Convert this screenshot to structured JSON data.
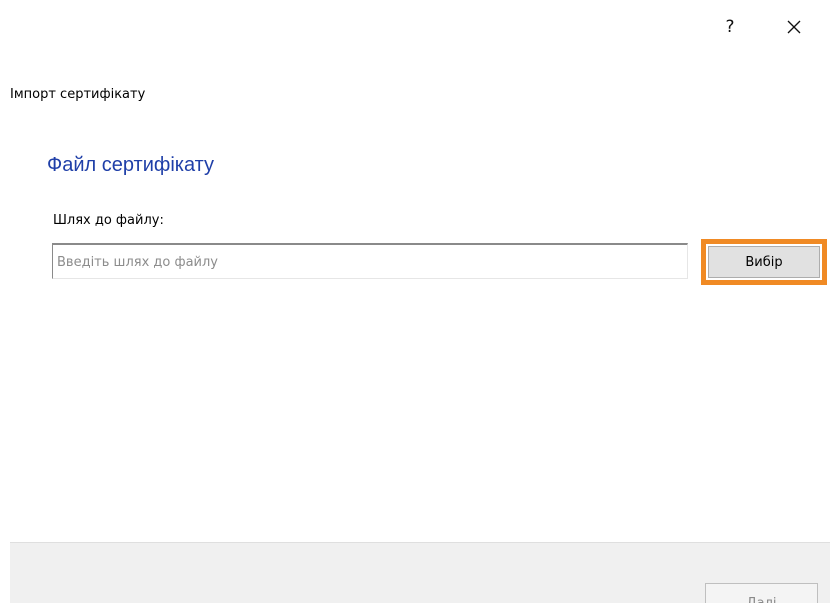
{
  "window": {
    "help_label": "?",
    "close_icon": "close-icon"
  },
  "wizard": {
    "title": "Імпорт сертифікату"
  },
  "section": {
    "heading": "Файл сертифікату",
    "path_label": "Шлях до файлу:",
    "path_value": "",
    "path_placeholder": "Введіть шлях до файлу",
    "browse_label": "Вибір"
  },
  "footer": {
    "next_label": "Далі",
    "next_enabled": false
  },
  "colors": {
    "heading": "#1f3fa8",
    "highlight": "#f08a24",
    "footer_bg": "#f0f0f0"
  }
}
